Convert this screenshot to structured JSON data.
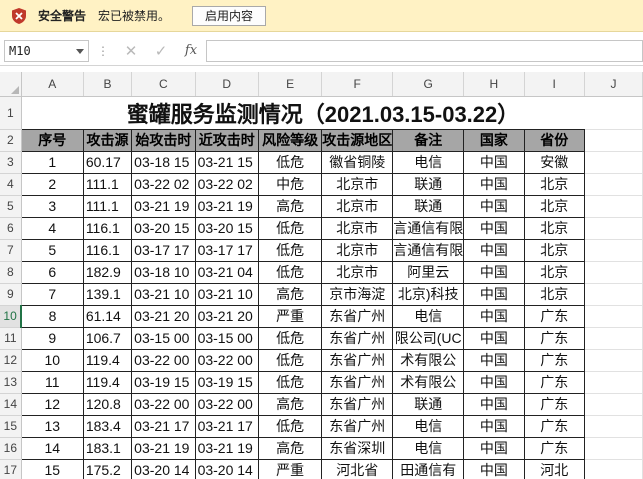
{
  "security_bar": {
    "title": "安全警告",
    "message": "宏已被禁用。",
    "button": "启用内容"
  },
  "formula_bar": {
    "name_box": "M10",
    "fx": "fx",
    "content": ""
  },
  "columns": [
    "A",
    "B",
    "C",
    "D",
    "E",
    "F",
    "G",
    "H",
    "I",
    "J"
  ],
  "sheet_title": "蜜罐服务监测情况（2021.03.15-03.22）",
  "headers": [
    "序号",
    "攻击源",
    "开始攻击时间",
    "最近攻击时间",
    "风险等级",
    "攻击源地区",
    "备注",
    "国家",
    "省份"
  ],
  "headers_visible": [
    "序号",
    "攻击源",
    "始攻击时",
    "近攻击时",
    "风险等级",
    "攻击源地区",
    "备注",
    "国家",
    "省份"
  ],
  "row_numbers": [
    "1",
    "2",
    "3",
    "4",
    "5",
    "6",
    "7",
    "8",
    "10",
    "11",
    "12",
    "13",
    "14",
    "15",
    "16",
    "17"
  ],
  "rows": [
    {
      "rn": "3",
      "no": "1",
      "ip": "60.17",
      "start": "03-18 15",
      "last": "03-21 15",
      "risk": "低危",
      "area": "徽省铜陵",
      "note": "电信",
      "country": "中国",
      "prov": "安徽"
    },
    {
      "rn": "4",
      "no": "2",
      "ip": "111.1",
      "start": "03-22 02",
      "last": "03-22 02",
      "risk": "中危",
      "area": "北京市",
      "note": "联通",
      "country": "中国",
      "prov": "北京"
    },
    {
      "rn": "5",
      "no": "3",
      "ip": "111.1",
      "start": "03-21 19",
      "last": "03-21 19",
      "risk": "高危",
      "area": "北京市",
      "note": "联通",
      "country": "中国",
      "prov": "北京"
    },
    {
      "rn": "6",
      "no": "4",
      "ip": "116.1",
      "start": "03-20 15",
      "last": "03-20 15",
      "risk": "低危",
      "area": "北京市",
      "note": "言通信有限",
      "country": "中国",
      "prov": "北京"
    },
    {
      "rn": "7",
      "no": "5",
      "ip": "116.1",
      "start": "03-17 17",
      "last": "03-17 17",
      "risk": "低危",
      "area": "北京市",
      "note": "言通信有限",
      "country": "中国",
      "prov": "北京"
    },
    {
      "rn": "8",
      "no": "6",
      "ip": "182.9",
      "start": "03-18 10",
      "last": "03-21 04",
      "risk": "低危",
      "area": "北京市",
      "note": "阿里云",
      "country": "中国",
      "prov": "北京"
    },
    {
      "rn": "9",
      "no": "7",
      "ip": "139.1",
      "start": "03-21 10",
      "last": "03-21 10",
      "risk": "高危",
      "area": "京市海淀",
      "note": "北京)科技",
      "country": "中国",
      "prov": "北京"
    },
    {
      "rn": "10",
      "no": "8",
      "ip": "61.14",
      "start": "03-21 20",
      "last": "03-21 20",
      "risk": "严重",
      "area": "东省广州",
      "note": "电信",
      "country": "中国",
      "prov": "广东"
    },
    {
      "rn": "11",
      "no": "9",
      "ip": "106.7",
      "start": "03-15 00",
      "last": "03-15 00",
      "risk": "低危",
      "area": "东省广州",
      "note": "限公司(UC",
      "country": "中国",
      "prov": "广东"
    },
    {
      "rn": "12",
      "no": "10",
      "ip": "119.4",
      "start": "03-22 00",
      "last": "03-22 00",
      "risk": "低危",
      "area": "东省广州",
      "note": "术有限公",
      "country": "中国",
      "prov": "广东"
    },
    {
      "rn": "13",
      "no": "11",
      "ip": "119.4",
      "start": "03-19 15",
      "last": "03-19 15",
      "risk": "低危",
      "area": "东省广州",
      "note": "术有限公",
      "country": "中国",
      "prov": "广东"
    },
    {
      "rn": "14",
      "no": "12",
      "ip": "120.8",
      "start": "03-22 00",
      "last": "03-22 00",
      "risk": "高危",
      "area": "东省广州",
      "note": "联通",
      "country": "中国",
      "prov": "广东"
    },
    {
      "rn": "15",
      "no": "13",
      "ip": "183.4",
      "start": "03-21 17",
      "last": "03-21 17",
      "risk": "低危",
      "area": "东省广州",
      "note": "电信",
      "country": "中国",
      "prov": "广东"
    },
    {
      "rn": "16",
      "no": "14",
      "ip": "183.1",
      "start": "03-21 19",
      "last": "03-21 19",
      "risk": "高危",
      "area": "东省深圳",
      "note": "电信",
      "country": "中国",
      "prov": "广东"
    },
    {
      "rn": "17",
      "no": "15",
      "ip": "175.2",
      "start": "03-20 14",
      "last": "03-20 14",
      "risk": "严重",
      "area": "河北省",
      "note": "田通信有",
      "country": "中国",
      "prov": "河北"
    }
  ]
}
